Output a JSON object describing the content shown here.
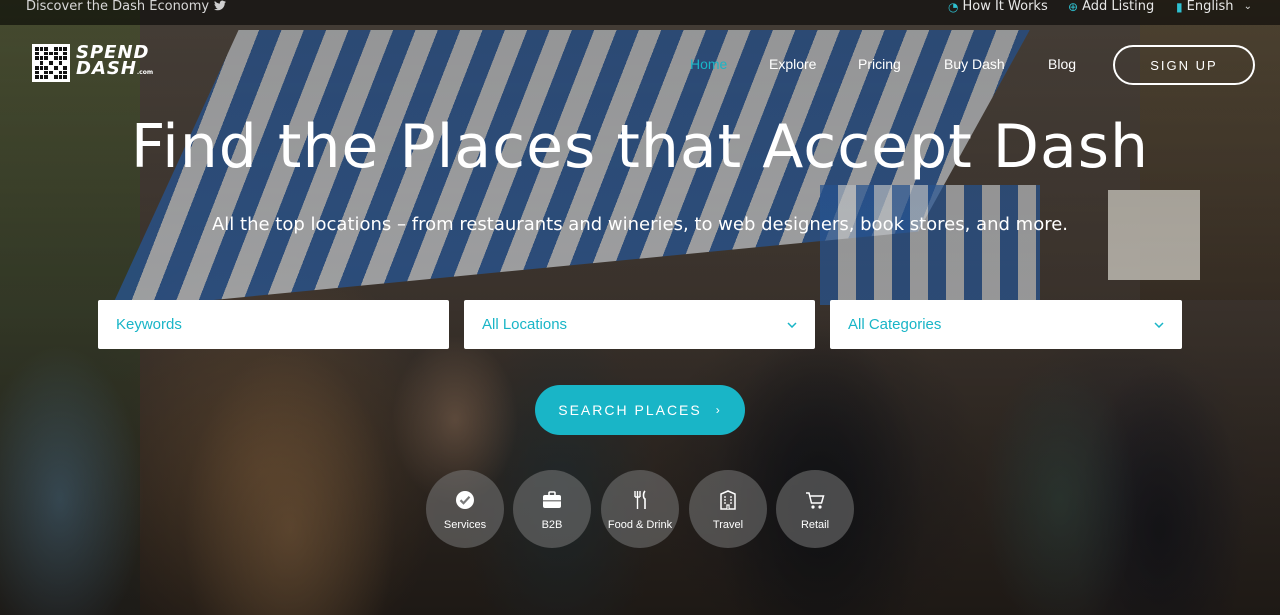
{
  "topbar": {
    "tagline": "Discover the Dash Economy",
    "social_icon": "twitter-icon",
    "how_it_works": "How It Works",
    "add_listing": "Add Listing",
    "language": "English"
  },
  "logo": {
    "line1": "SPEND",
    "line2": "DASH",
    "suffix": ".com"
  },
  "nav": {
    "items": [
      {
        "label": "Home",
        "active": true
      },
      {
        "label": "Explore",
        "active": false
      },
      {
        "label": "Pricing",
        "active": false
      },
      {
        "label": "Buy Dash",
        "active": false
      },
      {
        "label": "Blog",
        "active": false
      }
    ],
    "signup": "SIGN UP"
  },
  "hero": {
    "title": "Find the Places that Accept Dash",
    "subtitle": "All the top locations – from restaurants and wineries, to web designers, book stores, and more."
  },
  "search": {
    "keywords_placeholder": "Keywords",
    "location_value": "All Locations",
    "category_value": "All Categories",
    "button": "SEARCH PLACES"
  },
  "categories": [
    {
      "label": "Services",
      "icon": "check-circle-icon"
    },
    {
      "label": "B2B",
      "icon": "briefcase-icon"
    },
    {
      "label": "Food & Drink",
      "icon": "fork-knife-icon"
    },
    {
      "label": "Travel",
      "icon": "building-icon"
    },
    {
      "label": "Retail",
      "icon": "cart-icon"
    }
  ],
  "colors": {
    "accent": "#19b5c7",
    "white": "#ffffff",
    "topbar_bg": "rgba(0,0,0,0.55)"
  }
}
